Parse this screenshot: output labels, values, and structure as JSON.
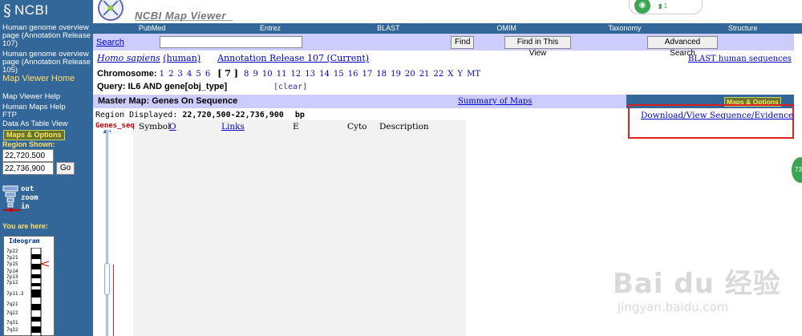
{
  "sidebar": {
    "logo_text": "NCBI",
    "links": [
      "Human genome overview page (Annotation Release 107)",
      "Human genome overview page (Annotation Release 105)"
    ],
    "map_viewer_home": "Map Viewer Home",
    "help_links": [
      "Map Viewer Help",
      "Human Maps Help",
      "FTP",
      "Data As Table View"
    ],
    "maps_options": "Maps & Options",
    "region_shown_label": "Region Shown:",
    "region_from": "22,720,500",
    "region_to": "22,736,900",
    "go_label": "Go",
    "zoom_out": "out",
    "zoom_word": "zoom",
    "zoom_in": "in",
    "you_are_here": "You are here:",
    "ideogram_title": "Ideogram",
    "ideogram_bands": [
      "7p22",
      "7p21",
      "7p15",
      "7p14",
      "7p13",
      "7p12",
      "7p11.2",
      "7q21",
      "7q22",
      "7q31",
      "7q32"
    ]
  },
  "header": {
    "title": "NCBI Map Viewer",
    "net_count": "1"
  },
  "nav": [
    "PubMed",
    "Entrez",
    "BLAST",
    "OMIM",
    "Taxonomy",
    "Structure"
  ],
  "search": {
    "link": "Search",
    "value": "",
    "find": "Find",
    "find_in_view": "Find in This View",
    "advanced": "Advanced Search"
  },
  "annotation": {
    "species": "Homo sapiens",
    "species_common": "(human)",
    "release": "Annotation Release 107 (Current)",
    "blast_link": "BLAST human sequences"
  },
  "chromosome": {
    "label": "Chromosome:",
    "before": [
      "1",
      "2",
      "3",
      "4",
      "5",
      "6"
    ],
    "selected": "[ 7 ]",
    "after": [
      "8",
      "9",
      "10",
      "11",
      "12",
      "13",
      "14",
      "15",
      "16",
      "17",
      "18",
      "19",
      "20",
      "21",
      "22",
      "X",
      "Y",
      "MT"
    ]
  },
  "query": {
    "label": "Query:",
    "value": "IL6 AND gene[obj_type]",
    "clear": "[clear]"
  },
  "master_map": {
    "title": "Master Map: Genes On Sequence",
    "summary_link": "Summary of Maps",
    "maps_options": "Maps & Options"
  },
  "region_displayed": {
    "label": "Region Displayed:",
    "range": "22,720,500-22,736,900",
    "unit": "bp"
  },
  "download_link": "Download/View Sequence/Evidence",
  "track": {
    "label": "Genes_seq",
    "columns": [
      "Symbol",
      "O",
      "Links",
      "E",
      "Cyto",
      "Description"
    ]
  },
  "side_bubble": "73",
  "watermark": {
    "main": "Bai du 经验",
    "sub": "jingyan.baidu.com"
  }
}
